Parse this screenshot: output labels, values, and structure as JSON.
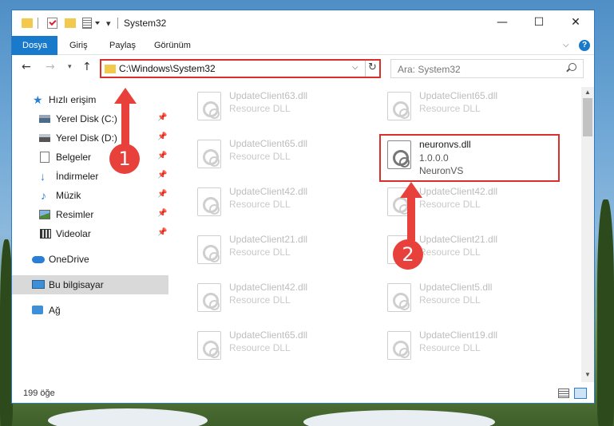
{
  "window": {
    "title": "System32",
    "controls": {
      "minimize": "—",
      "maximize": "☐",
      "close": "✕"
    }
  },
  "ribbon": {
    "tabs": [
      {
        "label": "Dosya",
        "active": true
      },
      {
        "label": "Giriş"
      },
      {
        "label": "Paylaş"
      },
      {
        "label": "Görünüm"
      }
    ],
    "help": "?"
  },
  "nav": {
    "address": "C:\\Windows\\System32",
    "search_placeholder": "Ara: System32"
  },
  "sidebar": {
    "items": [
      {
        "label": "Hızlı erişim",
        "icon": "star-icon"
      },
      {
        "label": "Yerel Disk (C:)",
        "icon": "drive-icon",
        "pinned": true
      },
      {
        "label": "Yerel Disk (D:)",
        "icon": "drive-icon",
        "pinned": true
      },
      {
        "label": "Belgeler",
        "icon": "document-icon",
        "pinned": true
      },
      {
        "label": "İndirmeler",
        "icon": "download-icon",
        "pinned": true
      },
      {
        "label": "Müzik",
        "icon": "music-icon",
        "pinned": true
      },
      {
        "label": "Resimler",
        "icon": "picture-icon",
        "pinned": true
      },
      {
        "label": "Videolar",
        "icon": "video-icon",
        "pinned": true
      },
      {
        "label": "OneDrive",
        "icon": "cloud-icon"
      },
      {
        "label": "Bu bilgisayar",
        "icon": "computer-icon",
        "selected": true
      },
      {
        "label": "Ağ",
        "icon": "network-icon"
      }
    ],
    "pin_glyph": "📌"
  },
  "files": [
    {
      "name": "UpdateClient63.dll",
      "type": "Resource DLL"
    },
    {
      "name": "UpdateClient65.dll",
      "type": "Resource DLL"
    },
    {
      "name": "UpdateClient65.dll",
      "type": "Resource DLL"
    },
    {
      "name": "neuronvs.dll",
      "version": "1.0.0.0",
      "company": "NeuronVS",
      "highlighted": true
    },
    {
      "name": "UpdateClient42.dll",
      "type": "Resource DLL"
    },
    {
      "name": "UpdateClient42.dll",
      "type": "Resource DLL"
    },
    {
      "name": "UpdateClient21.dll",
      "type": "Resource DLL"
    },
    {
      "name": "UpdateClient21.dll",
      "type": "Resource DLL"
    },
    {
      "name": "UpdateClient42.dll",
      "type": "Resource DLL"
    },
    {
      "name": "UpdateClient5.dll",
      "type": "Resource DLL"
    },
    {
      "name": "UpdateClient65.dll",
      "type": "Resource DLL"
    },
    {
      "name": "UpdateClient19.dll",
      "type": "Resource DLL"
    }
  ],
  "status": {
    "count": "199 öğe"
  },
  "annotations": {
    "step1": "1",
    "step2": "2"
  },
  "colors": {
    "accent": "#1979ca",
    "highlight": "#d9302c",
    "arrow": "#e8403a"
  }
}
